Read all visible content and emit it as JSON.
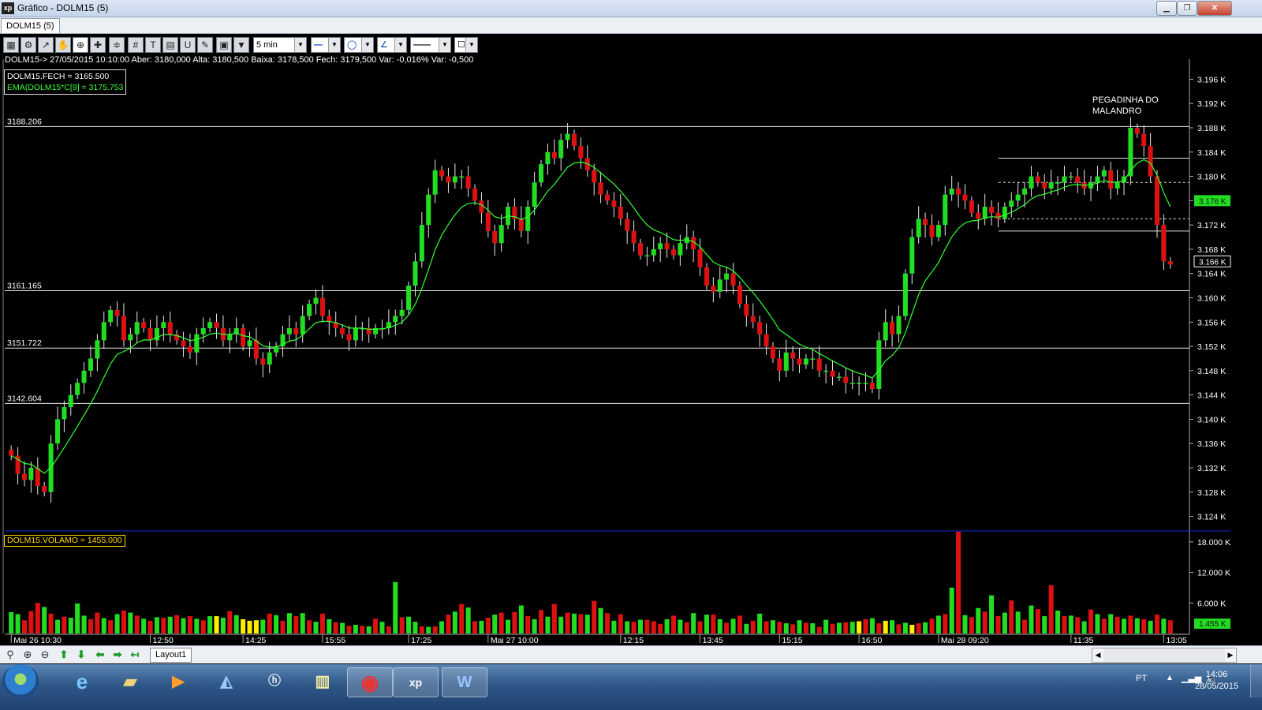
{
  "window": {
    "title": "Gráfico - DOLM15 (5)",
    "app_icon": "xp"
  },
  "doc_tab": "DOLM15 (5)",
  "toolbar": {
    "interval": "5 min"
  },
  "info_line": "DOLM15-> 27/05/2015 10:10:00 Aber: 3180,000 Alta: 3180,500 Baixa: 3178,500 Fech: 3179,500 Var: -0,016% Var: -0,500",
  "legend": {
    "close": "DOLM15.FECH = 3165.500",
    "ema": "EMA(DOLM15*C[9] = 3175.753"
  },
  "volume_legend": "DOLM15.VOLAMO = 1455.000",
  "annotation": {
    "line1": "PEGADINHA DO",
    "line2": "MALANDRO"
  },
  "bottom": {
    "layout_tab": "Layout1"
  },
  "taskbar": {
    "lang": "PT",
    "time": "14:06",
    "date": "28/05/2015",
    "xp_label": "xp"
  },
  "colors": {
    "up": "#22dd22",
    "down": "#dd1111",
    "ema": "#33ff33",
    "volume_neutral": "#ffee00",
    "background": "#000000"
  },
  "chart_data": [
    {
      "type": "candlestick",
      "title": "",
      "y_axis": {
        "min": 3122,
        "max": 3198,
        "ticks": [
          3124,
          3128,
          3132,
          3136,
          3140,
          3144,
          3148,
          3152,
          3156,
          3160,
          3164,
          3168,
          3172,
          3176,
          3180,
          3184,
          3188,
          3192,
          3196
        ],
        "tick_suffix": " K"
      },
      "x_labels": [
        "Mai 26 10:30",
        "12:50",
        "14:25",
        "15:55",
        "17:25",
        "Mai 27 10:00",
        "12:15",
        "13:45",
        "15:15",
        "16:50",
        "Mai 28 09:20",
        "11:35",
        "13:05"
      ],
      "x_label_positions": [
        0,
        21,
        35,
        47,
        60,
        72,
        92,
        104,
        116,
        128,
        140,
        160,
        174
      ],
      "levels": [
        {
          "value": 3188.206,
          "label": "3188.206"
        },
        {
          "value": 3161.165,
          "label": "3161.165"
        },
        {
          "value": 3151.722,
          "label": "3151.722"
        },
        {
          "value": 3142.604,
          "label": "3142.604"
        }
      ],
      "last_price_labels": [
        {
          "value": 3176,
          "label": "3.176 K"
        },
        {
          "value": 3166,
          "label": "3.166 K"
        }
      ],
      "close_path": [
        3134,
        3131,
        3130,
        3132,
        3129,
        3128,
        3136,
        3140,
        3142,
        3144,
        3146,
        3148,
        3150,
        3153,
        3156,
        3158,
        3157,
        3153,
        3154,
        3156,
        3155,
        3153,
        3155,
        3156,
        3154,
        3153,
        3152,
        3151,
        3154,
        3155,
        3156,
        3155,
        3153,
        3154,
        3155,
        3152,
        3153,
        3150,
        3149,
        3151,
        3152,
        3154,
        3155,
        3154,
        3157,
        3159,
        3160,
        3157,
        3156,
        3155,
        3154,
        3153,
        3155,
        3155,
        3154,
        3155,
        3155,
        3156,
        3157,
        3158,
        3162,
        3166,
        3172,
        3177,
        3181,
        3180,
        3179,
        3180,
        3180,
        3178,
        3176,
        3174,
        3171,
        3169,
        3172,
        3175,
        3173,
        3171,
        3175,
        3179,
        3182,
        3184,
        3183,
        3186,
        3187,
        3185,
        3183,
        3181,
        3179,
        3177,
        3176,
        3175,
        3173,
        3171,
        3169,
        3167,
        3167,
        3168,
        3169,
        3168,
        3167,
        3169,
        3170,
        3168,
        3165,
        3162,
        3161,
        3163,
        3164,
        3162,
        3159,
        3157,
        3156,
        3154,
        3152,
        3150,
        3148,
        3151,
        3150,
        3149,
        3150,
        3150,
        3148,
        3148,
        3147,
        3147,
        3146,
        3146,
        3146,
        3146,
        3145,
        3153,
        3156,
        3154,
        3157,
        3164,
        3170,
        3173,
        3172,
        3170,
        3172,
        3177,
        3178,
        3177,
        3176,
        3174,
        3173,
        3175,
        3174,
        3173,
        3175,
        3176,
        3177,
        3178,
        3180,
        3179,
        3178,
        3179,
        3179,
        3180,
        3180,
        3179,
        3178,
        3179,
        3180,
        3181,
        3178,
        3179,
        3180,
        3188,
        3187,
        3185,
        3180,
        3172,
        3166,
        3165.5
      ],
      "ema_label": "EMA(DOLM15*C[9]"
    },
    {
      "type": "bar",
      "title": "",
      "y_axis": {
        "min": 0,
        "max": 20000,
        "ticks": [
          6000,
          12000,
          18000
        ],
        "tick_labels": [
          "6.000 K",
          "12.000 K",
          "18.000 K"
        ]
      },
      "last_label": "1.455 K",
      "values": [
        4200,
        3800,
        2600,
        4400,
        6000,
        5200,
        3900,
        2700,
        3300,
        3100,
        5900,
        3500,
        2800,
        4100,
        3000,
        2600,
        3800,
        4500,
        4100,
        3500,
        2900,
        2500,
        3200,
        3100,
        3300,
        3600,
        3000,
        3400,
        2900,
        2600,
        3400,
        3400,
        3100,
        4400,
        3600,
        2800,
        2500,
        2600,
        2700,
        3900,
        3600,
        2500,
        4000,
        3400,
        4000,
        2600,
        2300,
        3900,
        2800,
        2200,
        2100,
        1500,
        1700,
        1500,
        1400,
        2900,
        2300,
        1400,
        10100,
        3200,
        3300,
        2300,
        1400,
        1300,
        1400,
        2400,
        3700,
        4300,
        5800,
        5100,
        2400,
        2500,
        3100,
        3700,
        4100,
        2700,
        4200,
        5500,
        3400,
        2800,
        4600,
        3300,
        5800,
        3300,
        4100,
        3900,
        3800,
        3700,
        6400,
        5000,
        4000,
        2500,
        3800,
        2400,
        2300,
        2700,
        2700,
        2400,
        1900,
        2800,
        3500,
        2700,
        2200,
        4000,
        2400,
        3700,
        3700,
        2800,
        2100,
        2900,
        3500,
        1900,
        2500,
        3900,
        2400,
        2600,
        2300,
        2000,
        1800,
        2600,
        2100,
        2000,
        1300,
        2700,
        1900,
        2100,
        2200,
        2300,
        2400,
        2800,
        3000,
        2000,
        2500,
        2600,
        1800,
        2100,
        1700,
        2000,
        2200,
        2900,
        3500,
        3800,
        9000,
        20000,
        3600,
        3200,
        5000,
        4300,
        7500,
        3400,
        4100,
        6500,
        4300,
        2700,
        5500,
        4800,
        3400,
        9500,
        4500,
        3400,
        3500,
        3200,
        2400,
        4700,
        3800,
        2900,
        3800,
        3300,
        2900,
        3500,
        3000,
        2800,
        2500,
        3700,
        2900,
        2600,
        3700,
        3300,
        2400
      ],
      "colors_code": "ggrrrgrgrgggrrgrgrgrgrgrgrgrgrgygrgyyygrgrgrgrgrgrgrgrgrgrgrggrgrgrgrgrgrgrgrgrgrgrgrgrgrgrgrgrgrrrgrgrgrgrgrgrgrgrgrgrgrgrgrgrgyrgrygrgyrgrgrgrgrgrgrgrgrgrgrgrgrgrgrgrgrgrgrgrrgrgrrgrgrgr"
    }
  ]
}
